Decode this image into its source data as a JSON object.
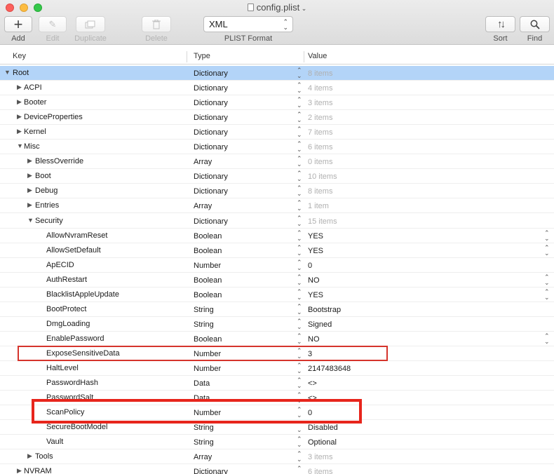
{
  "window": {
    "title": "config.plist"
  },
  "toolbar": {
    "add": {
      "label": "Add",
      "icon": "plus-icon"
    },
    "edit": {
      "label": "Edit",
      "icon": "pencil-icon"
    },
    "duplicate": {
      "label": "Duplicate",
      "icon": "duplicate-icon"
    },
    "delete": {
      "label": "Delete",
      "icon": "trash-icon"
    },
    "format": {
      "value": "XML",
      "label": "PLIST Format"
    },
    "sort": {
      "label": "Sort",
      "icon": "sort-arrows-icon"
    },
    "find": {
      "label": "Find",
      "icon": "magnifier-icon"
    }
  },
  "columns": {
    "key": "Key",
    "type": "Type",
    "value": "Value"
  },
  "rows": [
    {
      "key": "Root",
      "type": "Dictionary",
      "value": "8 items"
    },
    {
      "key": "ACPI",
      "type": "Dictionary",
      "value": "4 items"
    },
    {
      "key": "Booter",
      "type": "Dictionary",
      "value": "3 items"
    },
    {
      "key": "DeviceProperties",
      "type": "Dictionary",
      "value": "2 items"
    },
    {
      "key": "Kernel",
      "type": "Dictionary",
      "value": "7 items"
    },
    {
      "key": "Misc",
      "type": "Dictionary",
      "value": "6 items"
    },
    {
      "key": "BlessOverride",
      "type": "Array",
      "value": "0 items"
    },
    {
      "key": "Boot",
      "type": "Dictionary",
      "value": "10 items"
    },
    {
      "key": "Debug",
      "type": "Dictionary",
      "value": "8 items"
    },
    {
      "key": "Entries",
      "type": "Array",
      "value": "1 item"
    },
    {
      "key": "Security",
      "type": "Dictionary",
      "value": "15 items"
    },
    {
      "key": "AllowNvramReset",
      "type": "Boolean",
      "value": "YES"
    },
    {
      "key": "AllowSetDefault",
      "type": "Boolean",
      "value": "YES"
    },
    {
      "key": "ApECID",
      "type": "Number",
      "value": "0"
    },
    {
      "key": "AuthRestart",
      "type": "Boolean",
      "value": "NO"
    },
    {
      "key": "BlacklistAppleUpdate",
      "type": "Boolean",
      "value": "YES"
    },
    {
      "key": "BootProtect",
      "type": "String",
      "value": "Bootstrap"
    },
    {
      "key": "DmgLoading",
      "type": "String",
      "value": "Signed"
    },
    {
      "key": "EnablePassword",
      "type": "Boolean",
      "value": "NO"
    },
    {
      "key": "ExposeSensitiveData",
      "type": "Number",
      "value": "3"
    },
    {
      "key": "HaltLevel",
      "type": "Number",
      "value": "2147483648"
    },
    {
      "key": "PasswordHash",
      "type": "Data",
      "value": "<>"
    },
    {
      "key": "PasswordSalt",
      "type": "Data",
      "value": "<>"
    },
    {
      "key": "ScanPolicy",
      "type": "Number",
      "value": "0"
    },
    {
      "key": "SecureBootModel",
      "type": "String",
      "value": "Disabled"
    },
    {
      "key": "Vault",
      "type": "String",
      "value": "Optional"
    },
    {
      "key": "Tools",
      "type": "Array",
      "value": "3 items"
    },
    {
      "key": "NVRAM",
      "type": "Dictionary",
      "value": "6 items"
    }
  ],
  "colors": {
    "selection": "#b3d4f8",
    "highlight_box": "#e7251c",
    "item_count_text": "#b0b0b0"
  }
}
